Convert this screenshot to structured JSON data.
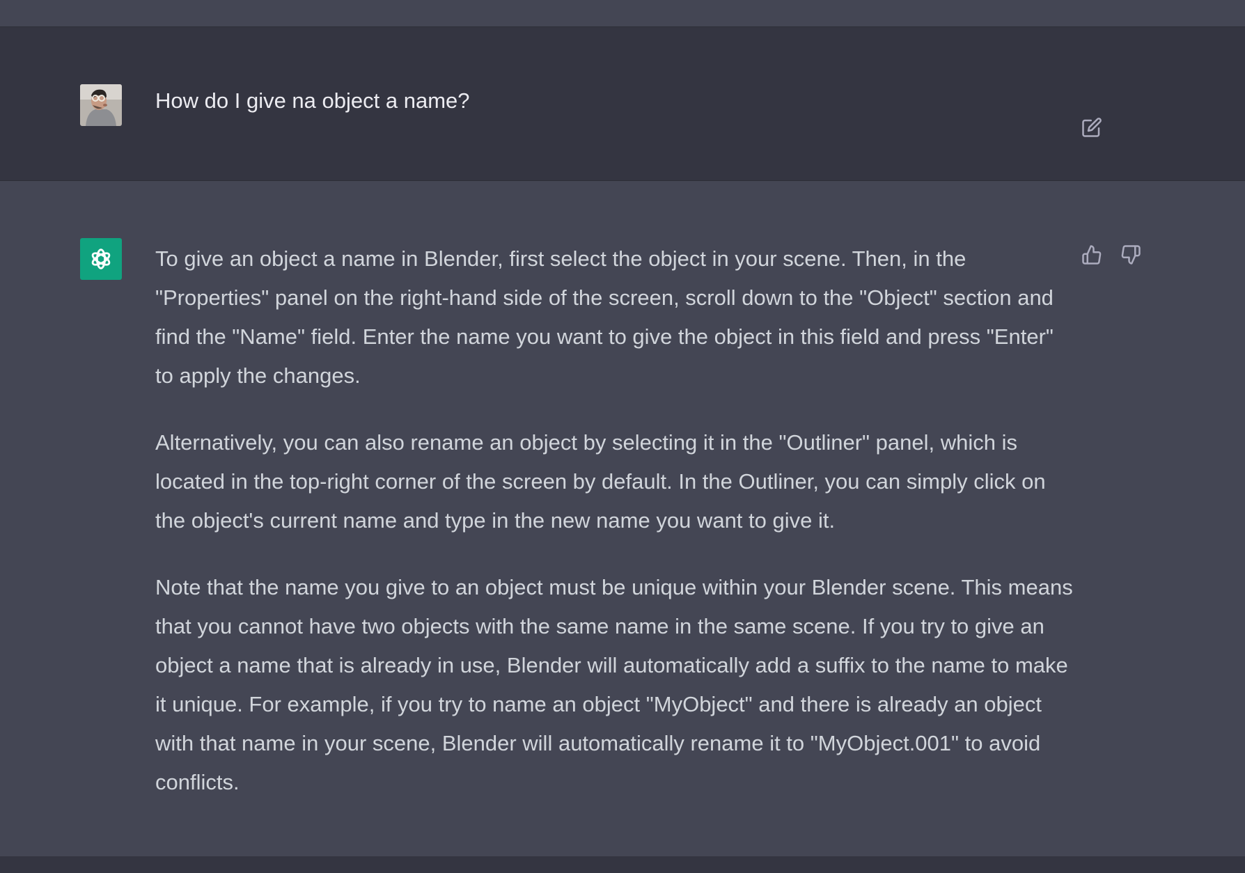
{
  "conversation": {
    "user_message": {
      "avatar_icon": "user-avatar-photo",
      "text": "How do I give na object a name?",
      "edit_icon": "edit-pencil-icon"
    },
    "assistant_message": {
      "avatar_icon": "openai-logo-icon",
      "avatar_color": "#10a37f",
      "paragraphs": [
        "To give an object a name in Blender, first select the object in your scene. Then, in the \"Properties\" panel on the right-hand side of the screen, scroll down to the \"Object\" section and find the \"Name\" field. Enter the name you want to give the object in this field and press \"Enter\" to apply the changes.",
        "Alternatively, you can also rename an object by selecting it in the \"Outliner\" panel, which is located in the top-right corner of the screen by default. In the Outliner, you can simply click on the object's current name and type in the new name you want to give it.",
        "Note that the name you give to an object must be unique within your Blender scene. This means that you cannot have two objects with the same name in the same scene. If you try to give an object a name that is already in use, Blender will automatically add a suffix to the name to make it unique. For example, if you try to name an object \"MyObject\" and there is already an object with that name in your scene, Blender will automatically rename it to \"MyObject.001\" to avoid conflicts."
      ],
      "feedback_icons": [
        "thumbs-up-icon",
        "thumbs-down-icon"
      ]
    }
  },
  "colors": {
    "user_bg": "#343541",
    "assistant_bg": "#444654",
    "text": "#d1d5db",
    "accent": "#10a37f"
  }
}
